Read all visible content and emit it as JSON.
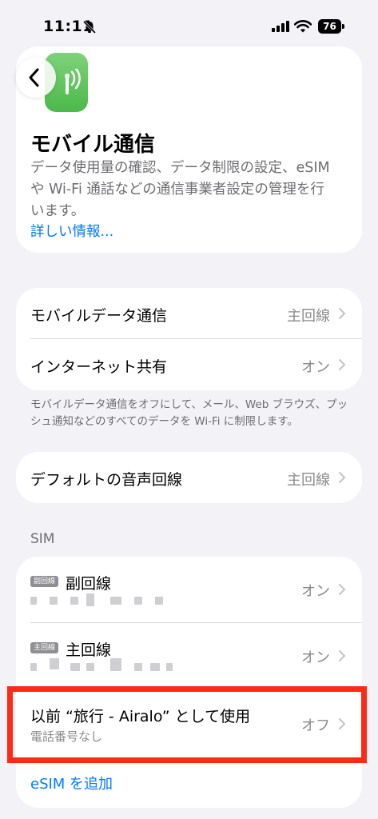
{
  "status_bar": {
    "time": "11:11",
    "battery": "76"
  },
  "header": {
    "back_label": "back",
    "title": "モバイル通信",
    "description": "データ使用量の確認、データ制限の設定、eSIM や Wi-Fi 通話などの通信事業者設定の管理を行います。",
    "learn_more": "詳しい情報..."
  },
  "group1": {
    "rows": [
      {
        "label": "モバイルデータ通信",
        "value": "主回線"
      },
      {
        "label": "インターネット共有",
        "value": "オン"
      }
    ],
    "footnote": "モバイルデータ通信をオフにして、メール、Web ブラウズ、プッシュ通知などのすべてのデータを Wi-Fi に制限します。"
  },
  "group2": {
    "rows": [
      {
        "label": "デフォルトの音声回線",
        "value": "主回線"
      }
    ]
  },
  "sim_section": {
    "header": "SIM",
    "lines": [
      {
        "badge": "副回線",
        "name": "副回線",
        "value": "オン"
      },
      {
        "badge": "主回線",
        "name": "主回線",
        "value": "オン"
      },
      {
        "name": "以前 “旅行 - Airalo” として使用",
        "sub": "電話番号なし",
        "value": "オフ"
      }
    ],
    "add_esim": "eSIM を追加"
  },
  "colors": {
    "accent": "#007AFF",
    "highlight": "#FF2A14",
    "background": "#F2F2F7"
  }
}
